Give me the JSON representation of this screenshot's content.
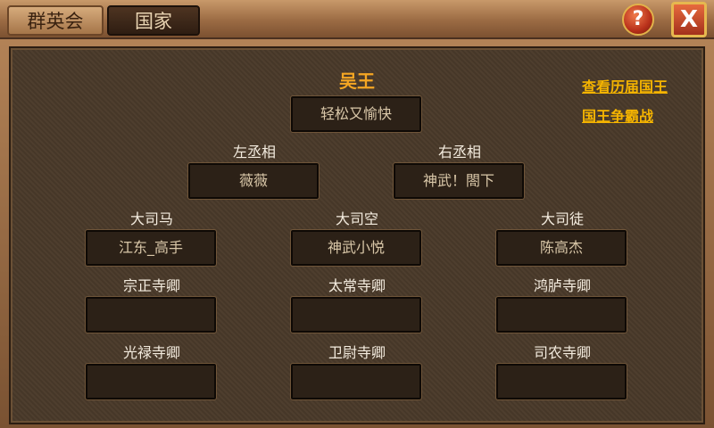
{
  "tabs": {
    "tab1": "群英会",
    "tab2": "国家"
  },
  "buttons": {
    "help": "?",
    "close": "X"
  },
  "king": {
    "title": "吴王",
    "name": "轻松又愉快"
  },
  "links": {
    "history": "查看历届国王",
    "battle": "国王争霸战"
  },
  "ministers": [
    {
      "title": "左丞相",
      "name": "薇薇"
    },
    {
      "title": "右丞相",
      "name": "神武！閤下"
    }
  ],
  "officials": [
    {
      "title": "大司马",
      "name": "江东_高手"
    },
    {
      "title": "大司空",
      "name": "神武小悦"
    },
    {
      "title": "大司徒",
      "name": "陈高杰"
    },
    {
      "title": "宗正寺卿",
      "name": ""
    },
    {
      "title": "太常寺卿",
      "name": ""
    },
    {
      "title": "鸿胪寺卿",
      "name": ""
    },
    {
      "title": "光禄寺卿",
      "name": ""
    },
    {
      "title": "卫尉寺卿",
      "name": ""
    },
    {
      "title": "司农寺卿",
      "name": ""
    }
  ]
}
